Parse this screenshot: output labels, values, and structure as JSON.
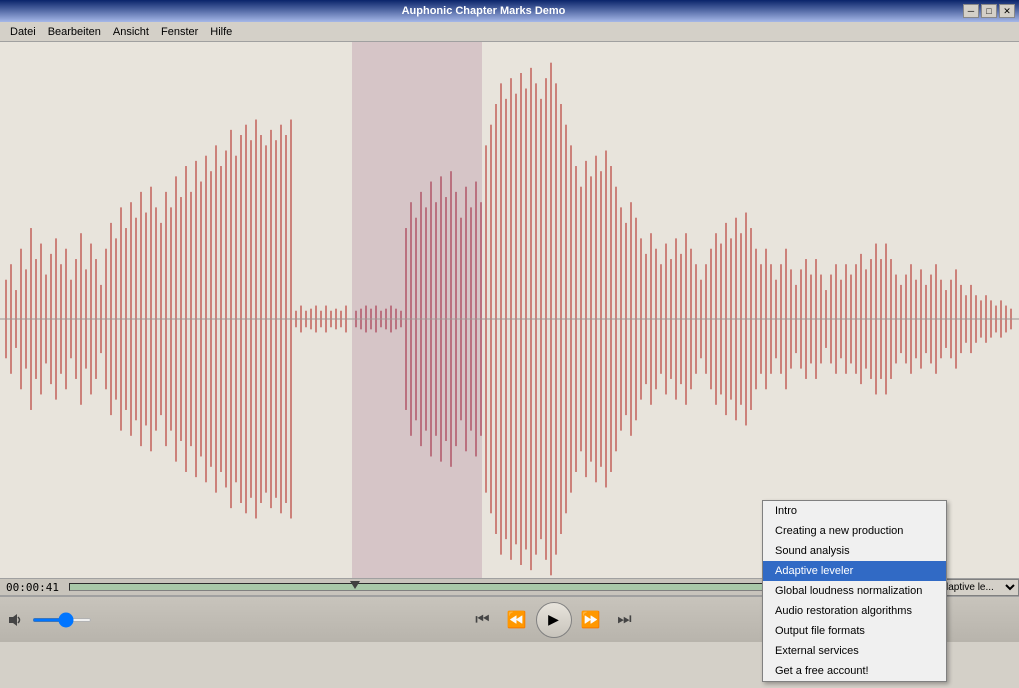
{
  "window": {
    "title": "Auphonic Chapter Marks Demo",
    "min_btn": "─",
    "max_btn": "□",
    "close_btn": "✕"
  },
  "menu": {
    "items": [
      "Datei",
      "Bearbeiten",
      "Ansicht",
      "Fenster",
      "Hilfe"
    ]
  },
  "timeline": {
    "current_time": "00:00:41",
    "chapter_label": "Adaptive le..."
  },
  "context_menu": {
    "items": [
      {
        "label": "Intro",
        "selected": false
      },
      {
        "label": "Creating a new production",
        "selected": false
      },
      {
        "label": "Sound analysis",
        "selected": false
      },
      {
        "label": "Adaptive leveler",
        "selected": true
      },
      {
        "label": "Global loudness normalization",
        "selected": false
      },
      {
        "label": "Audio restoration algorithms",
        "selected": false
      },
      {
        "label": "Output file formats",
        "selected": false
      },
      {
        "label": "External services",
        "selected": false
      },
      {
        "label": "Get a free account!",
        "selected": false
      }
    ]
  },
  "controls": {
    "skip_back_label": "⏮",
    "rewind_label": "⏪",
    "play_label": "▶",
    "forward_label": "⏩",
    "skip_fwd_label": "⏭"
  },
  "waveform": {
    "color_normal": "#c8706a",
    "color_selected": "#c87080",
    "color_light": "#d4a0a0"
  }
}
